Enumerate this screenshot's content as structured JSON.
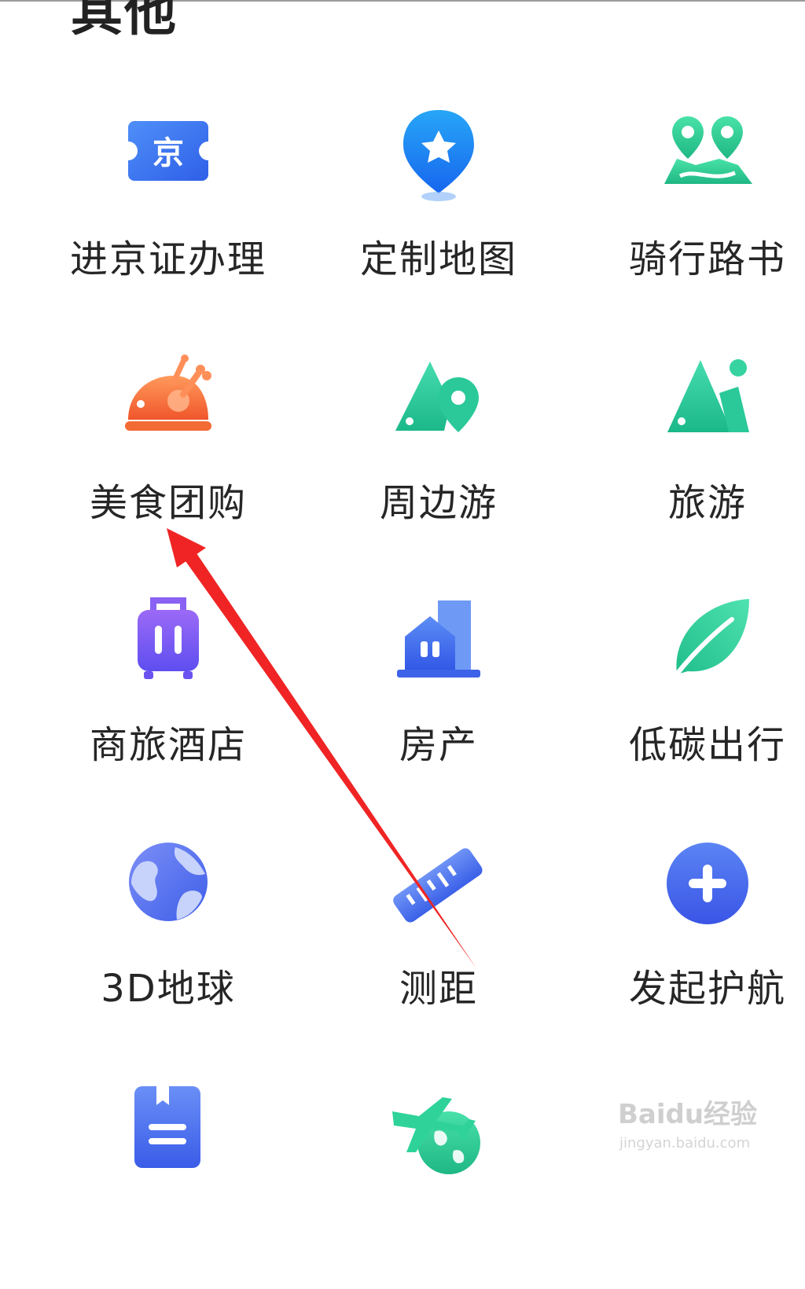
{
  "section": {
    "title": "其他"
  },
  "items": [
    {
      "label": "进京证办理",
      "icon": "jing-ticket-icon",
      "color": "#3f7cf5"
    },
    {
      "label": "定制地图",
      "icon": "star-pin-icon",
      "color": "#1e88f5"
    },
    {
      "label": "骑行路书",
      "icon": "route-map-icon",
      "color": "#2fd39a"
    },
    {
      "label": "美食团购",
      "icon": "roast-chicken-icon",
      "color": "#f2703a"
    },
    {
      "label": "周边游",
      "icon": "mountain-pin-icon",
      "color": "#2fd0a0"
    },
    {
      "label": "旅游",
      "icon": "mountain-person-icon",
      "color": "#2fcf98"
    },
    {
      "label": "商旅酒店",
      "icon": "suitcase-icon",
      "color": "#7a55f0"
    },
    {
      "label": "房产",
      "icon": "building-icon",
      "color": "#4a74f2"
    },
    {
      "label": "低碳出行",
      "icon": "leaf-icon",
      "color": "#2ecf97"
    },
    {
      "label": "3D地球",
      "icon": "globe-icon",
      "color": "#5a78f0"
    },
    {
      "label": "测距",
      "icon": "ruler-icon",
      "color": "#4a74f2"
    },
    {
      "label": "发起护航",
      "icon": "plus-circle-icon",
      "color": "#4a6cf0"
    },
    {
      "label": "",
      "icon": "bookmark-list-icon",
      "color": "#4a74f2"
    },
    {
      "label": "",
      "icon": "plane-globe-icon",
      "color": "#2fd39a"
    }
  ],
  "annotation": {
    "arrow_color": "#f02424"
  },
  "watermark": {
    "brand": "Baidu经验",
    "url": "jingyan.baidu.com"
  }
}
